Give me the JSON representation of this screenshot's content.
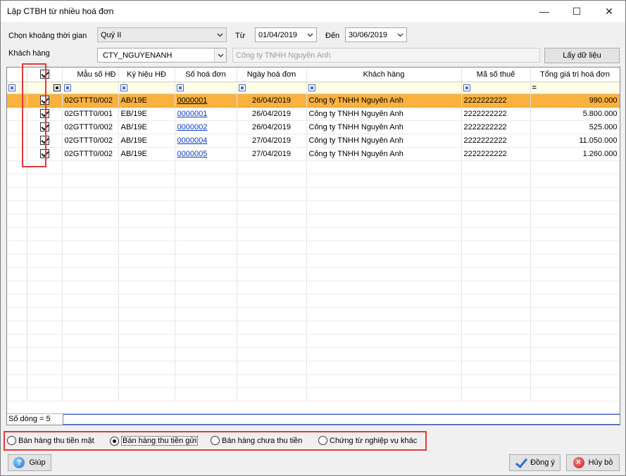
{
  "window": {
    "title": "Lập CTBH từ nhiều hoá đơn",
    "minimize_glyph": "—",
    "maximize_glyph": "☐",
    "close_glyph": "✕"
  },
  "filters": {
    "period_label": "Chọn khoảng thời gian",
    "period_value": "Quý II",
    "from_label": "Từ",
    "from_value": "01/04/2019",
    "to_label": "Đến",
    "to_value": "30/06/2019",
    "customer_label": "Khách hàng",
    "customer_code": "CTY_NGUYENANH",
    "customer_name": "Công ty TNHH Nguyên Anh",
    "fetch_button": "Lấy dữ liệu"
  },
  "grid": {
    "columns": [
      "Mẫu số HĐ",
      "Ký hiệu HĐ",
      "Số hoá đơn",
      "Ngày hoá đơn",
      "Khách hàng",
      "Mã số thuế",
      "Tổng giá trị hoá đơn"
    ],
    "rows": [
      {
        "mau_so": "02GTTT0/002",
        "ky_hieu": "AB/19E",
        "so_hd": "0000001",
        "ngay": "26/04/2019",
        "khach_hang": "Công ty TNHH Nguyên Anh",
        "mst": "2222222222",
        "tong": "990.000"
      },
      {
        "mau_so": "02GTTT0/001",
        "ky_hieu": "EB/19E",
        "so_hd": "0000001",
        "ngay": "26/04/2019",
        "khach_hang": "Công ty TNHH Nguyên Anh",
        "mst": "2222222222",
        "tong": "5.800.000"
      },
      {
        "mau_so": "02GTTT0/002",
        "ky_hieu": "AB/19E",
        "so_hd": "0000002",
        "ngay": "26/04/2019",
        "khach_hang": "Công ty TNHH Nguyên Anh",
        "mst": "2222222222",
        "tong": "525.000"
      },
      {
        "mau_so": "02GTTT0/002",
        "ky_hieu": "AB/19E",
        "so_hd": "0000004",
        "ngay": "27/04/2019",
        "khach_hang": "Công ty TNHH Nguyên Anh",
        "mst": "2222222222",
        "tong": "11.050.000"
      },
      {
        "mau_so": "02GTTT0/002",
        "ky_hieu": "AB/19E",
        "so_hd": "0000005",
        "ngay": "27/04/2019",
        "khach_hang": "Công ty TNHH Nguyên Anh",
        "mst": "2222222222",
        "tong": "1.260.000"
      }
    ],
    "status": "Số dòng = 5"
  },
  "options": {
    "items": [
      "Bán hàng thu tiền mặt",
      "Bán hàng thu tiền gửi",
      "Bán hàng chưa thu tiền",
      "Chứng từ nghiệp vụ khác"
    ],
    "selected_index": 1
  },
  "footer": {
    "help_button": "Giúp",
    "ok_button": "Đồng ý",
    "cancel_button": "Hủy bỏ"
  },
  "colors": {
    "selected_row": "#fbb13e",
    "filter_row": "#fffde6",
    "highlight": "#e53838",
    "link": "#0b3dc9"
  }
}
